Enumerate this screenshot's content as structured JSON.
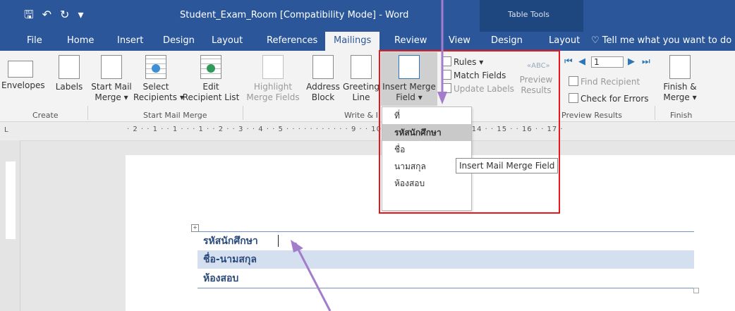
{
  "window": {
    "title": "Student_Exam_Room [Compatibility Mode]  -  Word",
    "contextual_title": "Table Tools"
  },
  "tabs": [
    "File",
    "Home",
    "Insert",
    "Design",
    "Layout",
    "References",
    "Mailings",
    "Review",
    "View",
    "Design",
    "Layout"
  ],
  "active_tab": "Mailings",
  "tell_me": "Tell me what you want to do",
  "ribbon": {
    "create": {
      "envelopes": "Envelopes",
      "labels": "Labels",
      "group": "Create"
    },
    "start_mail_merge": {
      "start_l1": "Start Mail",
      "start_l2": "Merge ▾",
      "select_l1": "Select",
      "select_l2": "Recipients ▾",
      "edit_l1": "Edit",
      "edit_l2": "Recipient List",
      "group": "Start Mail Merge"
    },
    "write_insert": {
      "highlight_l1": "Highlight",
      "highlight_l2": "Merge Fields",
      "address_l1": "Address",
      "address_l2": "Block",
      "greeting_l1": "Greeting",
      "greeting_l2": "Line",
      "insert_l1": "Insert Merge",
      "insert_l2": "Field ▾",
      "rules": "Rules ▾",
      "match": "Match Fields",
      "update": "Update Labels",
      "group": "Write & I"
    },
    "preview": {
      "preview_l1": "Preview",
      "preview_l2": "Results",
      "record": "1",
      "find": "Find Recipient",
      "check": "Check for Errors",
      "group": "Preview Results"
    },
    "finish": {
      "l1": "Finish &",
      "l2": "Merge ▾",
      "group": "Finish"
    }
  },
  "ruler_text": "· 2 · · 1 · · 1 ·  ·  · 1 · · 2 · · 3 · · 4 · · 5 · · ·  ·  ·  ·  ·  ·  ·  ·  · 9 · · 10 · · 11 · · 12 · · 13 · · 14 · · 15 · · 16 · · 17 ·",
  "merge_fields": [
    "ที่",
    "รหัสนักศึกษา",
    "ชื่อ",
    "นามสกุล",
    "ห้องสอบ"
  ],
  "highlighted_field": "รหัสนักศึกษา",
  "tooltip": "Insert Mail Merge Field",
  "document": {
    "rows": [
      "รหัสนักศึกษา",
      "ชื่อ-นามสกุล",
      "ห้องสอบ"
    ]
  },
  "colors": {
    "title_bar": "#2b579a",
    "highlight_box": "#e8171b",
    "arrow": "#a47ccc",
    "row_shade": "#d4dff0"
  }
}
